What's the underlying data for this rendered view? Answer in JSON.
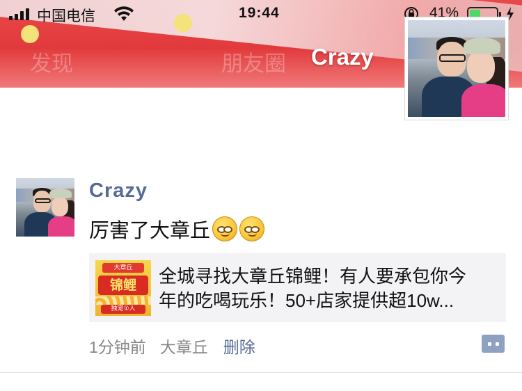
{
  "status_bar": {
    "carrier": "中国电信",
    "time": "19:44",
    "battery_percent": "41%",
    "battery_level": 0.41,
    "icons": [
      "signal-icon",
      "wifi-icon",
      "orientation-lock-icon",
      "battery-icon",
      "charging-bolt-icon"
    ]
  },
  "header": {
    "nav_left": "发现",
    "nav_title": "朋友圈",
    "cover_name": "Crazy"
  },
  "post": {
    "author": "Crazy",
    "text": "厉害了大章丘",
    "emoji_count": 2,
    "emoji": "grin-face-emoji",
    "link": {
      "title_line1": "全城寻找大章丘锦鲤！有人要承包你今",
      "title_line2": "年的吃喝玩乐！50+店家提供超10w...",
      "thumb_top": "大章丘",
      "thumb_main": "锦鲤",
      "thumb_bottom": "独宠①人"
    },
    "time": "1分钟前",
    "location": "大章丘",
    "delete_label": "删除"
  },
  "colors": {
    "link_blue": "#576b95",
    "cover_red": "#e23a3c",
    "card_bg": "#f3f3f5",
    "battery_green": "#4cd964"
  }
}
